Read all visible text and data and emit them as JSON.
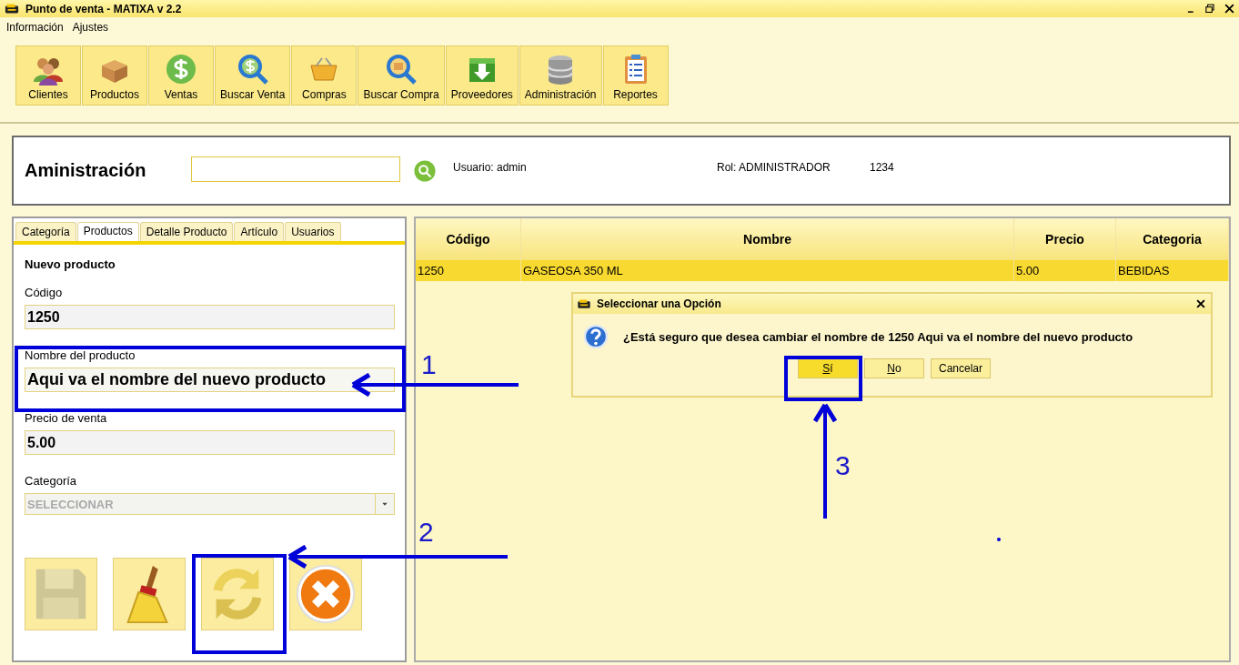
{
  "window": {
    "title": "Punto de venta - MATIXA v 2.2"
  },
  "menu": [
    {
      "label": "Información"
    },
    {
      "label": "Ajustes"
    }
  ],
  "toolbar": [
    {
      "label": "Clientes"
    },
    {
      "label": "Productos"
    },
    {
      "label": "Ventas"
    },
    {
      "label": "Buscar Venta"
    },
    {
      "label": "Compras"
    },
    {
      "label": "Buscar Compra"
    },
    {
      "label": "Proveedores"
    },
    {
      "label": "Administración"
    },
    {
      "label": "Reportes"
    }
  ],
  "header": {
    "title": "Aministración",
    "user": "Usuario: admin",
    "role": "Rol: ADMINISTRADOR",
    "code": "1234"
  },
  "tabs": [
    {
      "label": "Categoría",
      "selected": false
    },
    {
      "label": "Productos",
      "selected": true
    },
    {
      "label": "Detalle Producto",
      "selected": false
    },
    {
      "label": "Artículo",
      "selected": false
    },
    {
      "label": "Usuarios",
      "selected": false
    }
  ],
  "form": {
    "heading": "Nuevo producto",
    "fields": [
      {
        "kind": "text",
        "label": "Código",
        "value": "1250",
        "disabled": false
      },
      {
        "kind": "text",
        "label": "Nombre del producto",
        "value": "Aqui va el nombre del nuevo producto",
        "disabled": false
      },
      {
        "kind": "text",
        "label": "Precio de venta",
        "value": "5.00",
        "disabled": false
      },
      {
        "kind": "select",
        "label": "Categoría",
        "value": "SELECCIONAR",
        "disabled": true
      }
    ]
  },
  "actions": [
    {
      "disabled": true
    },
    {
      "disabled": false
    },
    {
      "disabled": false
    },
    {
      "disabled": false
    }
  ],
  "table": {
    "columns": [
      "Código",
      "Nombre",
      "Precio",
      "Categoria"
    ],
    "rows": [
      {
        "cells": [
          "1250",
          "GASEOSA 350 ML",
          "5.00",
          "BEBIDAS"
        ],
        "selected": true
      }
    ]
  },
  "dialog": {
    "title": "Seleccionar una Opción",
    "message": "¿Está seguro que desea cambiar el nombre de 1250 Aqui va el nombre del nuevo producto",
    "buttons": [
      {
        "label": "Sí",
        "selected": true,
        "underline_first": true
      },
      {
        "label": "No",
        "selected": false,
        "underline_first": true
      },
      {
        "label": "Cancelar",
        "selected": false,
        "underline_first": false
      }
    ]
  },
  "annotations": [
    {
      "label": "1"
    },
    {
      "label": "2"
    },
    {
      "label": "3"
    }
  ]
}
